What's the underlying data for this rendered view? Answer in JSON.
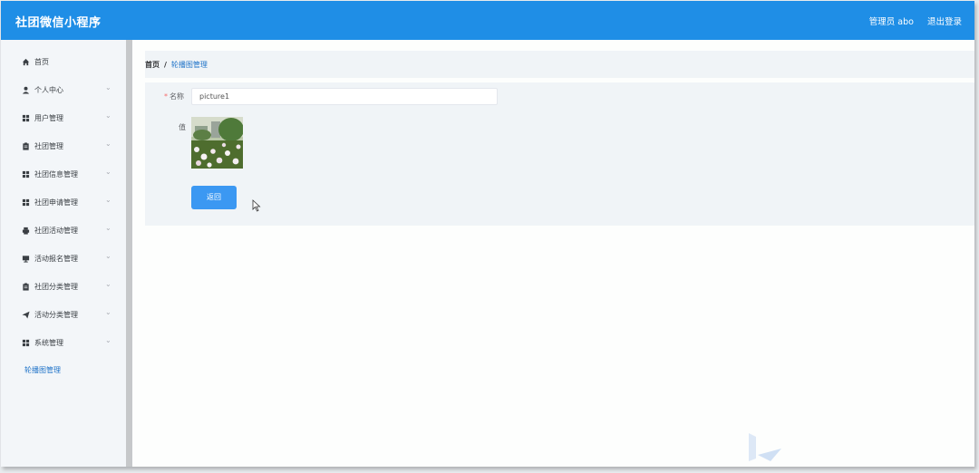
{
  "header": {
    "brand": "社团微信小程序",
    "admin_label": "管理员 abo",
    "logout_label": "退出登录"
  },
  "sidebar": {
    "items": [
      {
        "label": "首页",
        "icon": "home-icon",
        "has_submenu": false
      },
      {
        "label": "个人中心",
        "icon": "user-icon",
        "has_submenu": true
      },
      {
        "label": "用户管理",
        "icon": "grid-icon",
        "has_submenu": true
      },
      {
        "label": "社团管理",
        "icon": "clipboard-icon",
        "has_submenu": true
      },
      {
        "label": "社团信息管理",
        "icon": "grid-icon",
        "has_submenu": true
      },
      {
        "label": "社团申请管理",
        "icon": "grid-icon",
        "has_submenu": true
      },
      {
        "label": "社团活动管理",
        "icon": "printer-icon",
        "has_submenu": true
      },
      {
        "label": "活动报名管理",
        "icon": "monitor-icon",
        "has_submenu": true
      },
      {
        "label": "社团分类管理",
        "icon": "clipboard-icon",
        "has_submenu": true
      },
      {
        "label": "活动分类管理",
        "icon": "send-icon",
        "has_submenu": true
      },
      {
        "label": "系统管理",
        "icon": "grid-icon",
        "has_submenu": true
      }
    ],
    "subitem": "轮播图管理"
  },
  "breadcrumb": {
    "home": "首页",
    "separator": "/",
    "current": "轮播图管理"
  },
  "form": {
    "name_label": "名称",
    "name_value": "picture1",
    "value_label": "值",
    "back_button": "返回"
  },
  "colors": {
    "header_bg": "#1f8ee6",
    "accent": "#3b98f2",
    "link": "#1f73c8",
    "required": "#f56c6c"
  }
}
